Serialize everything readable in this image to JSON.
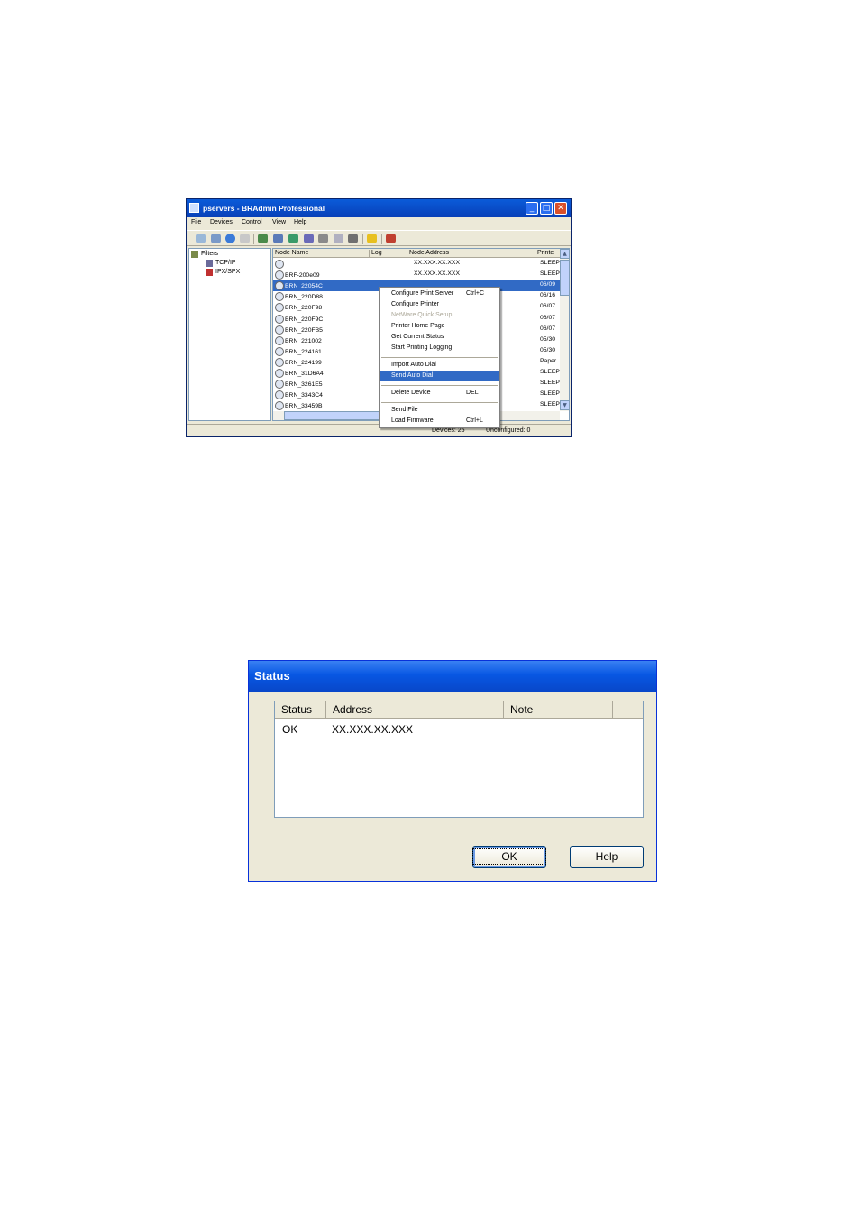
{
  "main_window": {
    "title": "pservers - BRAdmin Professional",
    "controls": {
      "minimize": "_",
      "maximize": "□",
      "close": "✕"
    },
    "menu": [
      "File",
      "Devices",
      "Control",
      "View",
      "Help"
    ],
    "tree": {
      "root": "Filters",
      "children": [
        "TCP/IP",
        "IPX/SPX"
      ]
    },
    "columns": [
      "Node Name",
      "Log",
      "Node Address",
      "Printe"
    ],
    "rows": [
      {
        "name": "",
        "address": "XX.XXX.XX.XXX",
        "status": "SLEEP"
      },
      {
        "name": "BRF-200e09",
        "address": "XX.XXX.XX.XXX",
        "status": "SLEEP"
      },
      {
        "name": "BRN_22054C",
        "address": "",
        "status": "06/09",
        "selected": true
      },
      {
        "name": "BRN_220D88",
        "address": "",
        "status": "06/16"
      },
      {
        "name": "BRN_220F98",
        "address": "",
        "status": "06/07"
      },
      {
        "name": "BRN_220F9C",
        "address": "",
        "status": "06/07"
      },
      {
        "name": "BRN_220FB5",
        "address": "",
        "status": "06/07"
      },
      {
        "name": "BRN_221002",
        "address": "",
        "status": "05/30"
      },
      {
        "name": "BRN_224161",
        "address": "",
        "status": "05/30"
      },
      {
        "name": "BRN_224199",
        "address": "",
        "status": "Paper"
      },
      {
        "name": "BRN_31D6A4",
        "address": "",
        "status": "SLEEP"
      },
      {
        "name": "BRN_3261E5",
        "address": "",
        "status": "SLEEP"
      },
      {
        "name": "BRN_3343C4",
        "address": "",
        "status": "SLEEP"
      },
      {
        "name": "BRN_33459B",
        "address": "",
        "status": "SLEEP"
      }
    ],
    "statusbar": {
      "devices": "Devices: 25",
      "unconfigured": "Unconfigured: 0"
    },
    "context_menu": [
      {
        "label": "Configure Print Server",
        "shortcut": "Ctrl+C"
      },
      {
        "label": "Configure Printer",
        "shortcut": ""
      },
      {
        "label": "NetWare Quick Setup",
        "shortcut": "",
        "disabled": true
      },
      {
        "label": "Printer Home Page",
        "shortcut": ""
      },
      {
        "label": "Get Current Status",
        "shortcut": ""
      },
      {
        "label": "Start Printing Logging",
        "shortcut": ""
      },
      {
        "label": "Import Auto Dial",
        "shortcut": ""
      },
      {
        "label": "Send Auto Dial",
        "shortcut": "",
        "highlighted": true
      },
      {
        "label": "Delete Device",
        "shortcut": "DEL"
      },
      {
        "label": "Send File",
        "shortcut": ""
      },
      {
        "label": "Load Firmware",
        "shortcut": "Ctrl+L"
      }
    ]
  },
  "status_dialog": {
    "title": "Status",
    "columns": [
      "Status",
      "Address",
      "Note"
    ],
    "rows": [
      {
        "status": "OK",
        "address": "XX.XXX.XX.XXX",
        "note": ""
      }
    ],
    "ok_label": "OK",
    "help_label": "Help"
  },
  "colors": {
    "selection": "#316ac5",
    "titlebar": "#0a5bd9",
    "face": "#ece9d8"
  }
}
